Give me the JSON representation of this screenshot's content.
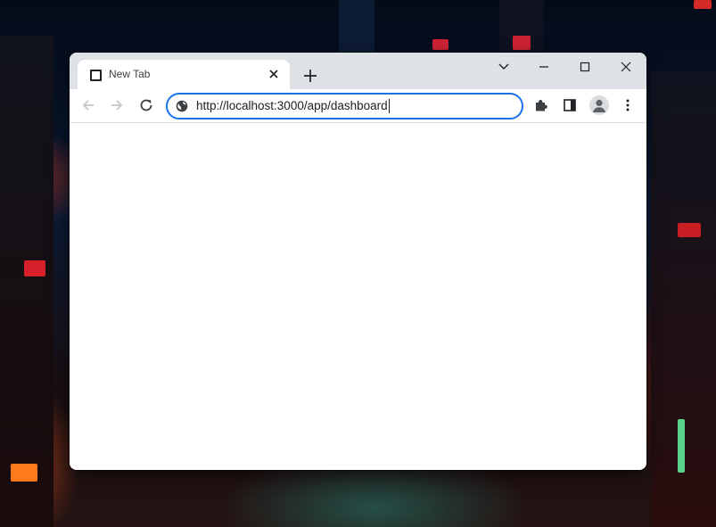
{
  "browser": {
    "tab": {
      "title": "New Tab",
      "favicon": "page-icon",
      "close_icon": "close-icon"
    },
    "new_tab_icon": "plus-icon",
    "window_controls": {
      "tab_search_icon": "chevron-down-icon",
      "minimize_icon": "minimize-icon",
      "maximize_icon": "maximize-icon",
      "close_icon": "close-icon"
    },
    "toolbar": {
      "back_icon": "arrow-left-icon",
      "forward_icon": "arrow-right-icon",
      "reload_icon": "reload-icon",
      "site_info_icon": "globe-icon",
      "url": "http://localhost:3000/app/dashboard",
      "extensions_icon": "puzzle-icon",
      "side_panel_icon": "side-panel-icon",
      "profile_icon": "person-icon",
      "menu_icon": "more-vert-icon"
    }
  },
  "colors": {
    "tabstrip_bg": "#dee1e6",
    "omnibox_focus": "#1a73e8",
    "icon": "#5f6368",
    "icon_disabled": "#c4c7c5"
  }
}
